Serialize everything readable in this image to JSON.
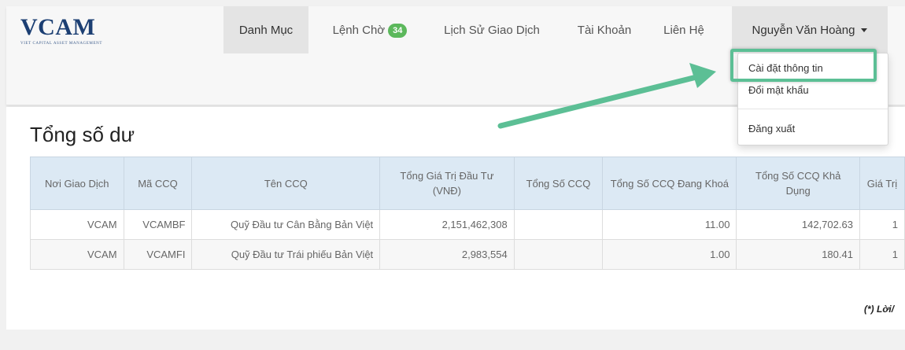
{
  "brand": {
    "name": "VCAM",
    "tagline": "VIET CAPITAL ASSET MANAGEMENT"
  },
  "nav": {
    "items": [
      {
        "label": "Danh Mục",
        "active": true
      },
      {
        "label": "Lệnh Chờ",
        "badge": "34"
      },
      {
        "label": "Lịch Sử Giao Dịch"
      },
      {
        "label": "Tài Khoản"
      },
      {
        "label": "Liên Hệ"
      }
    ],
    "user": "Nguyễn Văn Hoàng"
  },
  "dropdown": {
    "items": [
      "Cài đặt thông tin",
      "Đổi mật khẩu",
      "Đăng xuất"
    ]
  },
  "page": {
    "title": "Tổng số dư",
    "note": "(*) Lời/"
  },
  "table": {
    "headers": [
      "Nơi Giao Dịch",
      "Mã CCQ",
      "Tên CCQ",
      "Tổng Giá Trị Đầu Tư (VNĐ)",
      "Tổng Số CCQ",
      "Tổng Số CCQ Đang Khoá",
      "Tổng Số CCQ Khả Dụng",
      "Giá Trị"
    ],
    "rows": [
      [
        "VCAM",
        "VCAMBF",
        "Quỹ Đầu tư Cân Bằng Bản Việt",
        "2,151,462,308",
        "",
        "11.00",
        "142,702.63",
        "1"
      ],
      [
        "VCAM",
        "VCAMFI",
        "Quỹ Đầu tư Trái phiếu Bản Việt",
        "2,983,554",
        "",
        "1.00",
        "180.41",
        "1"
      ]
    ]
  },
  "colors": {
    "brand": "#1c3f73",
    "badge": "#5cb85c",
    "highlight": "#5cbf95",
    "table_header": "#dce9f4"
  }
}
